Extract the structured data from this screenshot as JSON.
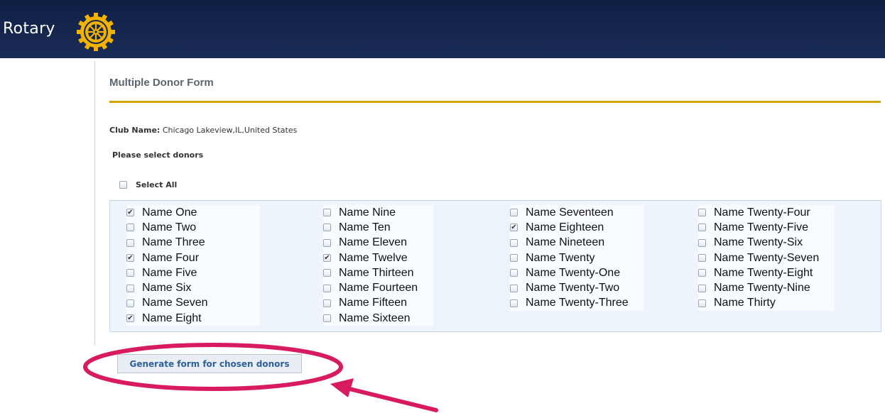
{
  "header": {
    "brand": "Rotary"
  },
  "form": {
    "title": "Multiple Donor Form",
    "club_label": "Club Name:",
    "club_value": "Chicago Lakeview,IL,United States",
    "prompt": "Please select donors",
    "select_all": {
      "label": "Select All",
      "checked": false
    },
    "submit_label": "Generate form for chosen donors"
  },
  "donors": [
    [
      {
        "name": "Name One",
        "checked": true
      },
      {
        "name": "Name Two",
        "checked": false
      },
      {
        "name": "Name Three",
        "checked": false
      },
      {
        "name": "Name Four",
        "checked": true
      },
      {
        "name": "Name Five",
        "checked": false
      },
      {
        "name": "Name Six",
        "checked": false
      },
      {
        "name": "Name Seven",
        "checked": false
      },
      {
        "name": "Name Eight",
        "checked": true
      }
    ],
    [
      {
        "name": "Name Nine",
        "checked": false
      },
      {
        "name": "Name Ten",
        "checked": false
      },
      {
        "name": "Name Eleven",
        "checked": false
      },
      {
        "name": "Name Twelve",
        "checked": true
      },
      {
        "name": "Name Thirteen",
        "checked": false
      },
      {
        "name": "Name Fourteen",
        "checked": false
      },
      {
        "name": "Name Fifteen",
        "checked": false
      },
      {
        "name": "Name Sixteen",
        "checked": false
      }
    ],
    [
      {
        "name": "Name Seventeen",
        "checked": false
      },
      {
        "name": "Name Eighteen",
        "checked": true
      },
      {
        "name": "Name Nineteen",
        "checked": false
      },
      {
        "name": "Name Twenty",
        "checked": false
      },
      {
        "name": "Name Twenty-One",
        "checked": false
      },
      {
        "name": "Name Twenty-Two",
        "checked": false
      },
      {
        "name": "Name Twenty-Three",
        "checked": false
      }
    ],
    [
      {
        "name": "Name Twenty-Four",
        "checked": false
      },
      {
        "name": "Name Twenty-Five",
        "checked": false
      },
      {
        "name": "Name Twenty-Six",
        "checked": false
      },
      {
        "name": "Name Twenty-Seven",
        "checked": false
      },
      {
        "name": "Name Twenty-Eight",
        "checked": false
      },
      {
        "name": "Name Twenty-Nine",
        "checked": false
      },
      {
        "name": "Name Thirty",
        "checked": false
      }
    ]
  ],
  "colors": {
    "header_bg": "#14254c",
    "gold_rule": "#d4a400",
    "panel_bg": "#eef4fb",
    "button_text": "#2d5f9a",
    "annotation": "#d81b60"
  }
}
